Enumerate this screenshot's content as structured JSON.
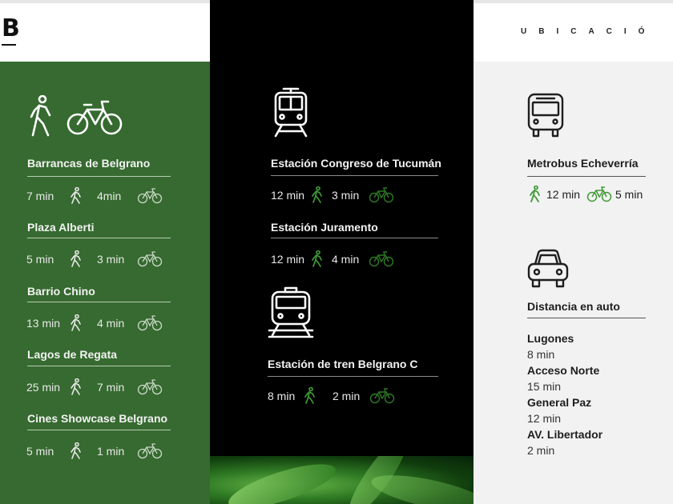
{
  "header": {
    "logo": "B",
    "section_label": "UBICACIÓ"
  },
  "green_column": {
    "items": [
      {
        "name": "Barrancas de Belgrano",
        "walk": "7 min",
        "bike": "4min"
      },
      {
        "name": "Plaza Alberti",
        "walk": "5 min",
        "bike": "3 min"
      },
      {
        "name": "Barrio Chino",
        "walk": "13 min",
        "bike": "4 min"
      },
      {
        "name": "Lagos de Regata",
        "walk": "25 min",
        "bike": "7 min"
      },
      {
        "name": "Cines Showcase Belgrano",
        "walk": "5 min",
        "bike": "1 min"
      }
    ]
  },
  "black_column": {
    "subway": [
      {
        "name": "Estación Congreso de Tucumán",
        "walk": "12 min",
        "bike": "3 min"
      },
      {
        "name": "Estación Juramento",
        "walk": "12 min",
        "bike": "4 min"
      }
    ],
    "train": {
      "name": "Estación de tren Belgrano C",
      "walk": "8 min",
      "bike": "2 min"
    }
  },
  "grey_column": {
    "bus": {
      "name": "Metrobus Echeverría",
      "walk": "12 min",
      "bike": "5 min"
    },
    "car": {
      "title": "Distancia en auto",
      "destinations": [
        {
          "name": "Lugones",
          "time": "8 min"
        },
        {
          "name": "Acceso Norte",
          "time": "15 min"
        },
        {
          "name": "General Paz",
          "time": "12 min"
        },
        {
          "name": "AV. Libertador",
          "time": "2 min"
        }
      ]
    }
  },
  "colors": {
    "green": "#366a30",
    "black": "#000000",
    "grey": "#f2f2f2",
    "accent_green": "#3f9a34"
  },
  "icons": [
    "walking-person-icon",
    "bicycle-icon",
    "subway-icon",
    "train-icon",
    "bus-icon",
    "car-icon"
  ]
}
